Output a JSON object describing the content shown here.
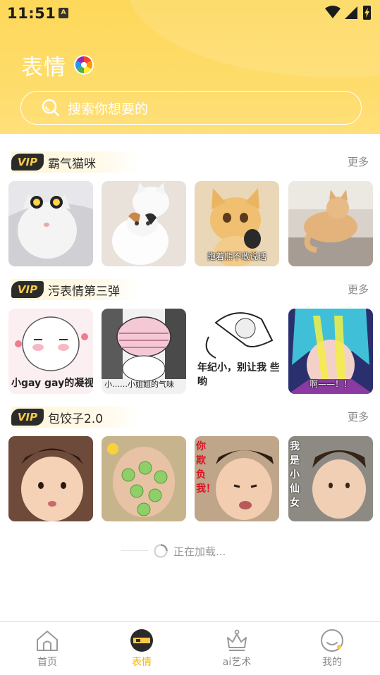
{
  "status_bar": {
    "time": "11:51",
    "notif_letter": "A"
  },
  "header": {
    "title": "表情",
    "search_placeholder": "搜索你想要的"
  },
  "sections": [
    {
      "badge": "VIP",
      "title": "霸气猫咪",
      "more": "更多",
      "thumbs": [
        {
          "caption": ""
        },
        {
          "caption": ""
        },
        {
          "caption": "抱着熊不敢说话"
        },
        {
          "caption": ""
        }
      ]
    },
    {
      "badge": "VIP",
      "title": "污表情第三弹",
      "more": "更多",
      "thumbs": [
        {
          "caption": "小gay gay的凝视"
        },
        {
          "caption": "小……小姐姐的气味"
        },
        {
          "caption": "年纪小，别让我 些哟"
        },
        {
          "caption": "啊——！！"
        }
      ]
    },
    {
      "badge": "VIP",
      "title": "包饺子2.0",
      "more": "更多",
      "thumbs": [
        {
          "caption": ""
        },
        {
          "caption": ""
        },
        {
          "caption": "你欺负我！"
        },
        {
          "caption": "我是小仙女"
        }
      ]
    }
  ],
  "loading": {
    "text": "正在加载..."
  },
  "bottom_nav": [
    {
      "label": "首页",
      "icon": "home-icon",
      "active": false
    },
    {
      "label": "表情",
      "icon": "emoji-icon",
      "active": true
    },
    {
      "label": "ai艺术",
      "icon": "crown-icon",
      "active": false
    },
    {
      "label": "我的",
      "icon": "profile-icon",
      "active": false
    }
  ],
  "colors": {
    "accent": "#f5b700",
    "header": "#fdd85a",
    "vip_bg": "#2b2b2b",
    "vip_text": "#f7c948"
  }
}
